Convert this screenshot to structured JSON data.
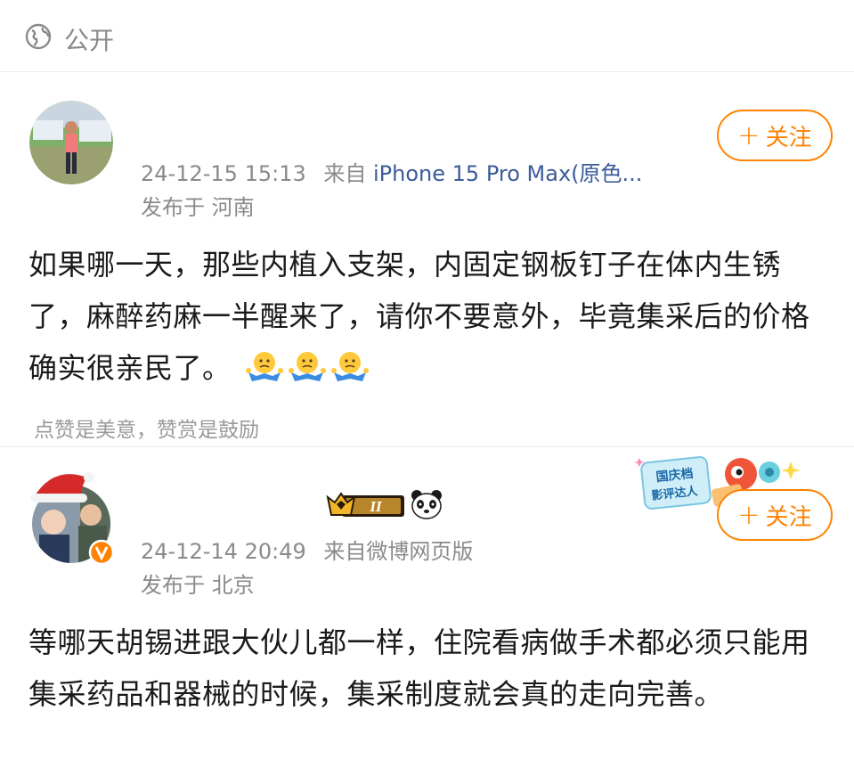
{
  "header": {
    "visibility_icon": "globe-icon",
    "visibility_label": "公开"
  },
  "posts": [
    {
      "avatar_icon": "user-avatar",
      "follow_label": "关注",
      "follow_icon": "plus-icon",
      "time": "24-12-15 15:13",
      "source_prefix": "来自",
      "source": "iPhone 15 Pro Max(原色...",
      "location": "发布于 河南",
      "text": "如果哪一天，那些内植入支架，内固定钢板钉子在体内生锈了，麻醉药麻一半醒来了，请你不要意外，毕竟集采后的价格确实很亲民了。",
      "emojis": [
        "shrug-emoji",
        "shrug-emoji",
        "shrug-emoji"
      ],
      "reward_tip": "点赞是美意，赞赏是鼓励"
    },
    {
      "avatar_icon": "user-avatar-christmas-hat",
      "verified_icon": "verified-v-badge",
      "level_badge": "II",
      "level_icon": "crown-icon",
      "extra_icon": "panda-icon",
      "sticker_text_1": "国庆档",
      "sticker_text_2": "影评达人",
      "follow_label": "关注",
      "follow_icon": "plus-icon",
      "time": "24-12-14 20:49",
      "source_prefix": "来自",
      "source": "微博网页版",
      "location": "发布于 北京",
      "text": "等哪天胡锡进跟大伙儿都一样，住院看病做手术都必须只能用集采药品和器械的时候，集采制度就会真的走向完善。"
    }
  ],
  "colors": {
    "accent": "#ff8200",
    "meta": "#8a8a8a",
    "link": "#3b5b9a",
    "divider": "#ececec"
  }
}
